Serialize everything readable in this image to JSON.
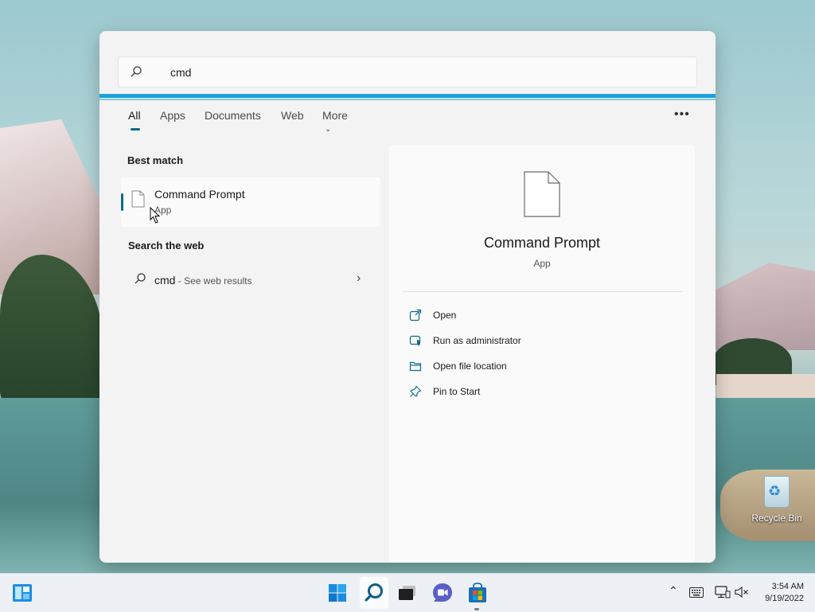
{
  "search": {
    "query": "cmd"
  },
  "tabs": [
    {
      "label": "All",
      "active": true
    },
    {
      "label": "Apps"
    },
    {
      "label": "Documents"
    },
    {
      "label": "Web"
    },
    {
      "label": "More"
    }
  ],
  "sections": {
    "best_match": "Best match",
    "search_web": "Search the web"
  },
  "best_match": {
    "name": "Command Prompt",
    "type": "App"
  },
  "web_result": {
    "query": "cmd",
    "suffix": " - See web results"
  },
  "detail": {
    "name": "Command Prompt",
    "type": "App",
    "actions": [
      {
        "label": "Open",
        "icon": "open-external-icon"
      },
      {
        "label": "Run as administrator",
        "icon": "shield-icon"
      },
      {
        "label": "Open file location",
        "icon": "folder-icon"
      },
      {
        "label": "Pin to Start",
        "icon": "pin-icon"
      }
    ]
  },
  "desktop": {
    "recycle_bin": "Recycle Bin"
  },
  "taskbar": {
    "apps": [
      "widgets-icon",
      "start-icon",
      "search-icon",
      "task-view-icon",
      "teams-chat-icon",
      "store-icon"
    ],
    "clock": {
      "time": "3:54 AM",
      "date": "9/19/2022"
    }
  },
  "colors": {
    "accent": "#0f6a88",
    "search_focus": "#1ea0dc"
  }
}
